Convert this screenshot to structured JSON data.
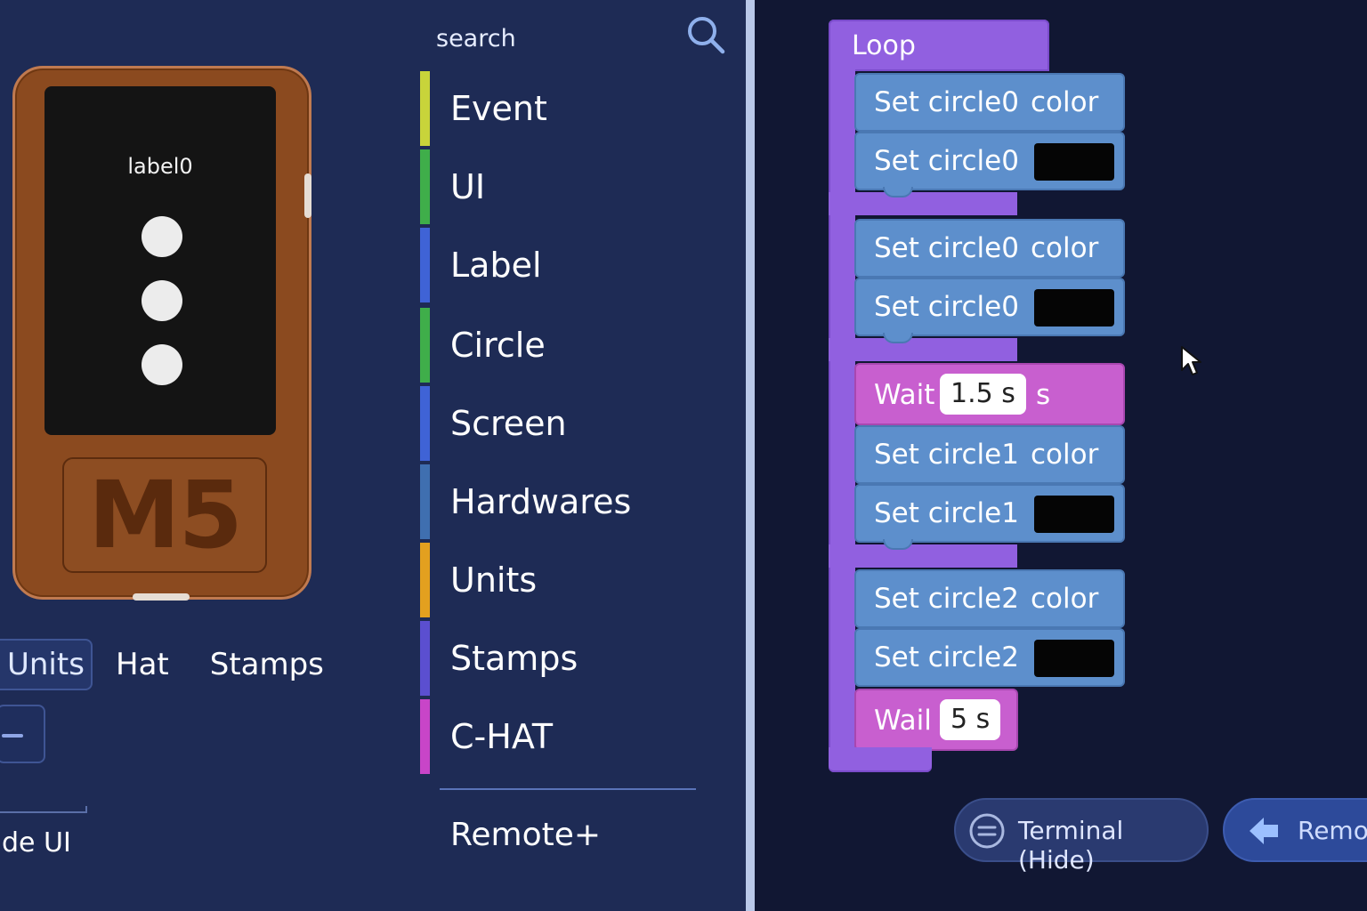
{
  "device": {
    "screen_label": "label0",
    "logo_text": "M5",
    "circle_count": 3
  },
  "left_panel": {
    "tabs": [
      {
        "label": "Units",
        "selected": true
      },
      {
        "label": "Hat",
        "selected": false
      },
      {
        "label": "Stamps",
        "selected": false
      }
    ],
    "hide_ui_label": "de UI"
  },
  "palette": {
    "search_placeholder": "search",
    "categories": [
      {
        "label": "Event",
        "color": "#c8d43a"
      },
      {
        "label": "UI",
        "color": "#3fae4a"
      },
      {
        "label": "Label",
        "color": "#3f63d6"
      },
      {
        "label": "Circle",
        "color": "#3fae4a"
      },
      {
        "label": "Screen",
        "color": "#3f63d6"
      },
      {
        "label": "Hardwares",
        "color": "#3f6fb0"
      },
      {
        "label": "Units",
        "color": "#e3a01f"
      },
      {
        "label": "Stamps",
        "color": "#5b4fd0"
      },
      {
        "label": "C-HAT",
        "color": "#c845c8"
      }
    ],
    "extra": "Remote+"
  },
  "workspace": {
    "loop_label": "Loop",
    "blocks": [
      {
        "type": "set-color",
        "text": "Set circle0",
        "field": "color"
      },
      {
        "type": "set-swatch",
        "text": "Set circle0",
        "swatch": "#050505"
      },
      {
        "type": "set-color",
        "text": "Set circle0",
        "field": "color"
      },
      {
        "type": "set-swatch",
        "text": "Set circle0",
        "swatch": "#050505"
      },
      {
        "type": "wait",
        "text": "Wait",
        "value": "1.5 s",
        "unit": "s"
      },
      {
        "type": "set-color",
        "text": "Set circle1",
        "field": "color"
      },
      {
        "type": "set-swatch",
        "text": "Set circle1",
        "swatch": "#050505"
      },
      {
        "type": "set-color",
        "text": "Set circle2",
        "field": "color"
      },
      {
        "type": "set-swatch",
        "text": "Set circle2",
        "swatch": "#050505"
      },
      {
        "type": "wait",
        "text": "Wail",
        "value": "5 s"
      }
    ],
    "terminal_button": "Terminal (Hide)",
    "remote_button": "Remot"
  },
  "colors": {
    "loop_block": "#9160e0",
    "set_block": "#5d8fcc",
    "wait_block": "#c85fcf",
    "device_body": "#8b4a1f"
  }
}
